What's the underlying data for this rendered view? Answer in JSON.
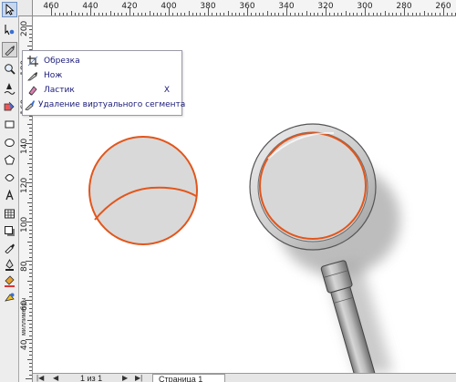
{
  "rulers": {
    "horizontal_labels": [
      "460",
      "440",
      "420",
      "400",
      "380",
      "360",
      "340",
      "320",
      "300",
      "280",
      "260"
    ],
    "vertical_labels": [
      "200",
      "180",
      "160",
      "140",
      "120",
      "100",
      "80",
      "60",
      "40"
    ],
    "units": "миллиметры"
  },
  "flyout": {
    "items": [
      {
        "label": "Обрезка",
        "icon": "crop-icon",
        "shortcut": ""
      },
      {
        "label": "Нож",
        "icon": "knife-icon",
        "shortcut": ""
      },
      {
        "label": "Ластик",
        "icon": "eraser-icon",
        "shortcut": "X"
      },
      {
        "label": "Удаление виртуального сегмента",
        "icon": "virtual-segment-delete-icon",
        "shortcut": ""
      }
    ]
  },
  "status": {
    "page_counter": "1 из 1",
    "page_tab": "Страница 1"
  },
  "colors": {
    "accent_orange": "#e2561c",
    "shape_fill": "#d9d9d9",
    "toolbar_bg": "#ededed"
  }
}
